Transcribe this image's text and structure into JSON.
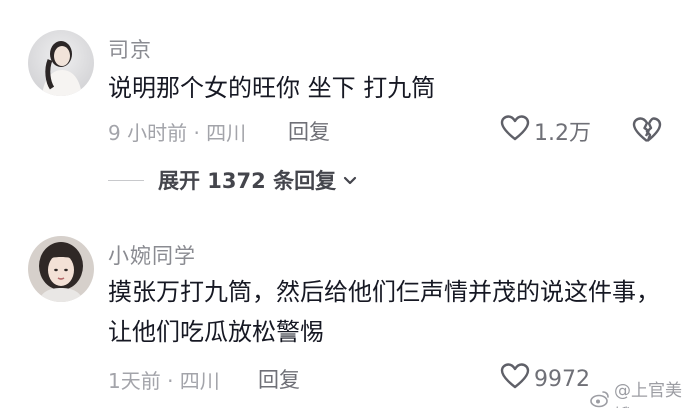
{
  "comments": [
    {
      "username": "司京",
      "text": "说明那个女的旺你 坐下 打九筒",
      "meta": "9 小时前 · 四川",
      "reply_label": "回复",
      "like_count": "1.2万",
      "expand_label": "展开 1372 条回复"
    },
    {
      "username": "小婉同学",
      "text": "摸张万打九筒，然后给他们仨声情并茂的说这件事，让他们吃瓜放松警惕",
      "meta": "1天前 · 四川",
      "reply_label": "回复",
      "like_count": "9972"
    }
  ],
  "watermark": {
    "text": "@上官美娥"
  },
  "icons": {
    "like": "heart-outline-icon",
    "dislike": "broken-heart-icon",
    "expand": "chevron-down-icon",
    "watermark": "weibo-logo-icon"
  },
  "colors": {
    "text_primary": "#161823",
    "text_secondary": "#8a8b91",
    "meta": "#a3a4aa"
  }
}
